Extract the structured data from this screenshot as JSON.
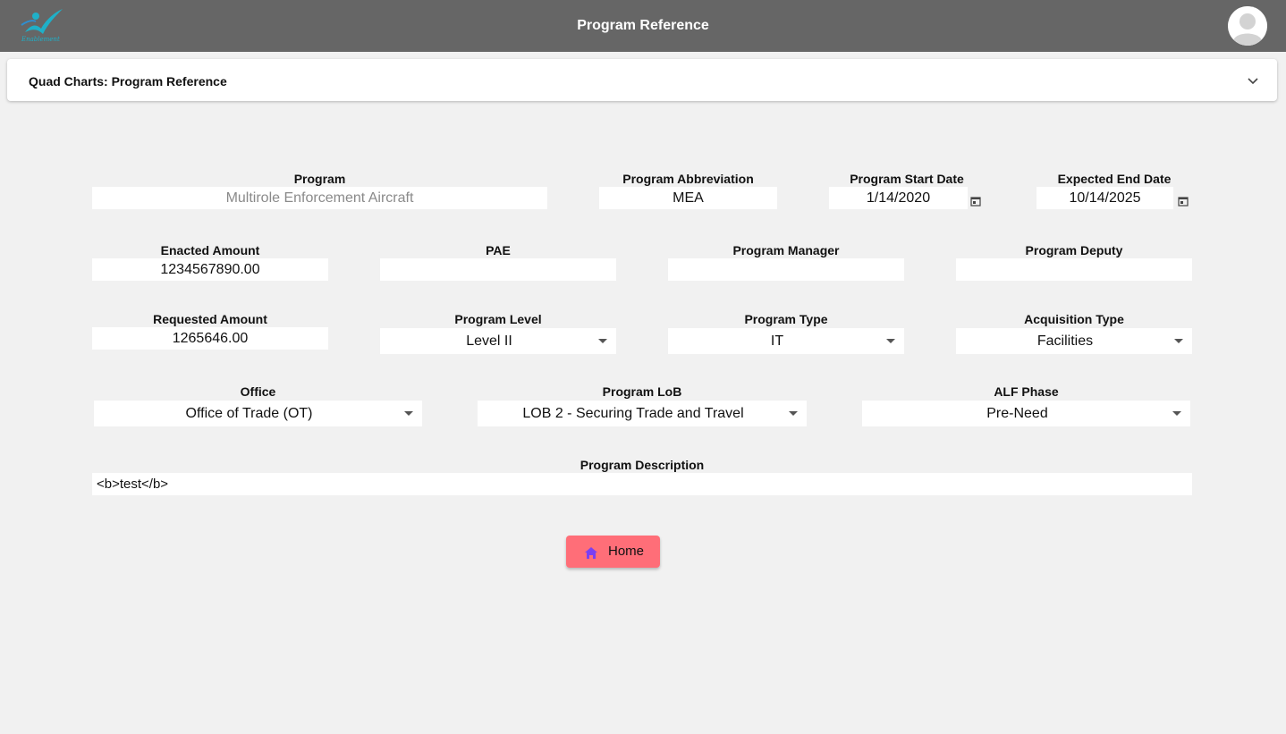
{
  "header": {
    "title": "Program Reference",
    "logo_text": "Enablement",
    "avatar_icon": "user-avatar-icon"
  },
  "panel": {
    "title": "Quad Charts: Program Reference",
    "toggle_icon": "chevron-down-icon"
  },
  "form": {
    "program": {
      "label": "Program",
      "value": "Multirole Enforcement Aircraft"
    },
    "abbreviation": {
      "label": "Program Abbreviation",
      "value": "MEA"
    },
    "start_date": {
      "label": "Program Start Date",
      "value": "1/14/2020"
    },
    "end_date": {
      "label": "Expected End Date",
      "value": "10/14/2025"
    },
    "enacted_amount": {
      "label": "Enacted Amount",
      "value": "1234567890.00"
    },
    "pae": {
      "label": "PAE",
      "value": ""
    },
    "program_manager": {
      "label": "Program Manager",
      "value": ""
    },
    "program_deputy": {
      "label": "Program Deputy",
      "value": ""
    },
    "requested_amount": {
      "label": "Requested Amount",
      "value": "1265646.00"
    },
    "program_level": {
      "label": "Program Level",
      "value": "Level II"
    },
    "program_type": {
      "label": "Program Type",
      "value": "IT"
    },
    "acquisition_type": {
      "label": "Acquisition Type",
      "value": "Facilities"
    },
    "office": {
      "label": "Office",
      "value": "Office of Trade (OT)"
    },
    "program_lob": {
      "label": "Program LoB",
      "value": "LOB 2 - Securing Trade and Travel"
    },
    "alf_phase": {
      "label": "ALF Phase",
      "value": "Pre-Need"
    },
    "description": {
      "label": "Program Description",
      "value": "<b>test</b>"
    }
  },
  "home_button": {
    "label": "Home",
    "icon": "home-icon"
  },
  "colors": {
    "header_bg": "#666666",
    "page_bg": "#f1f1f1",
    "home_button_bg": "#ff6e78",
    "home_icon": "#7b3ff2",
    "logo_accent": "#1fb0c8"
  }
}
